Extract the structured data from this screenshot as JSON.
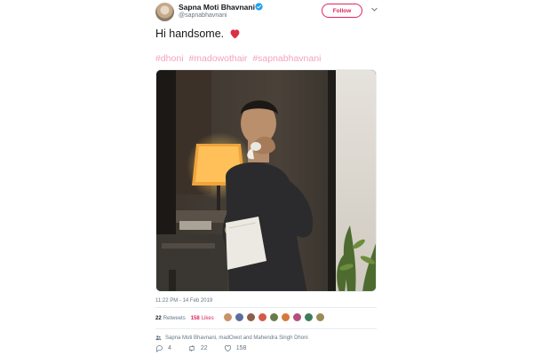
{
  "user": {
    "name": "Sapna Moti Bhavnani",
    "handle": "@sapnabhavnani"
  },
  "follow_label": "Follow",
  "tweet": {
    "text": "Hi handsome.",
    "hashtags": [
      "#dhoni",
      "#madowothair",
      "#sapnabhavnani"
    ]
  },
  "timestamp": "11:22 PM - 14 Feb 2019",
  "stats": {
    "retweets_count": "22",
    "retweets_label": "Retweets",
    "likes_count": "158",
    "likes_label": "Likes"
  },
  "participants": "Sapna Moti Bhavnani, madOwot and Mahendra Singh Dhoni",
  "actions": {
    "replies": "4",
    "retweets": "22",
    "likes": "158"
  },
  "colors": {
    "accent": "#e0245e",
    "hashtag": "#f3a3bc",
    "verified": "#1da1f2",
    "muted": "#657786"
  },
  "icons": [
    "verified-badge-icon",
    "chevron-down-icon",
    "heart-emoji-icon",
    "people-icon",
    "reply-icon",
    "retweet-icon",
    "like-icon"
  ]
}
